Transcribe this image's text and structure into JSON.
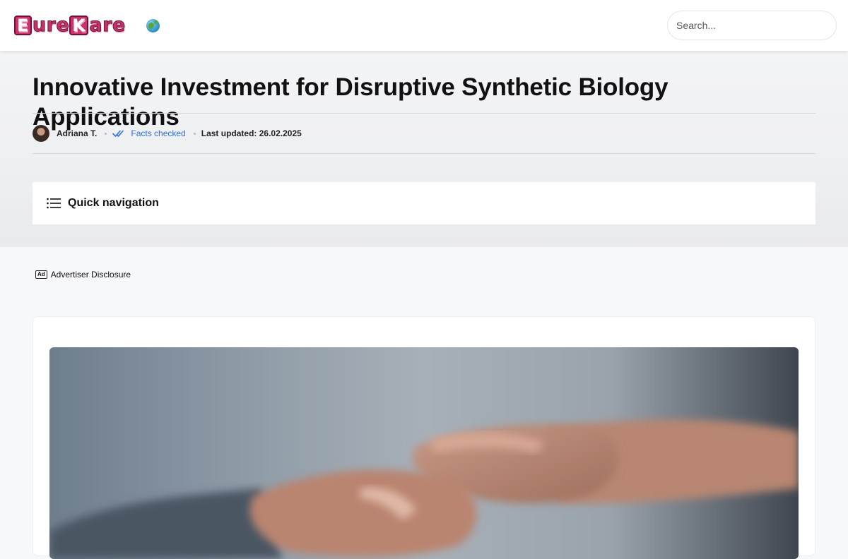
{
  "header": {
    "logo_text": "EureKare",
    "search": {
      "placeholder": "Search...",
      "value": ""
    }
  },
  "article": {
    "title": "Innovative Investment for Disruptive Synthetic Biology Applications",
    "author": "Adriana T.",
    "facts_checked": "Facts checked",
    "last_updated": "Last updated: 26.02.2025"
  },
  "quick_navigation": {
    "label": "Quick navigation"
  },
  "disclosure": {
    "icon_label": "Ad",
    "label": "Advertiser Disclosure"
  },
  "image": {
    "subject": "hands-holding"
  },
  "colors": {
    "accent_link": "#2a6fdb",
    "logo": "#c23469",
    "hero_background": "#eeeff1",
    "page_background": "#f7f8fa"
  }
}
